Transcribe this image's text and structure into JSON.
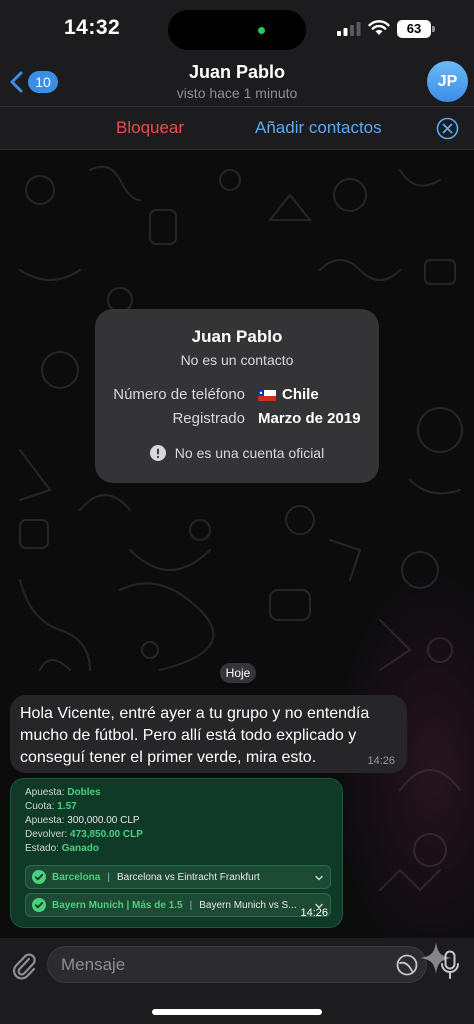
{
  "status_bar": {
    "time": "14:32",
    "battery": "63"
  },
  "header": {
    "back_count": "10",
    "name": "Juan Pablo",
    "last_seen": "visto hace 1 minuto",
    "avatar_initials": "JP"
  },
  "action_bar": {
    "block": "Bloquear",
    "add_contacts": "Añadir contactos"
  },
  "info_card": {
    "name": "Juan Pablo",
    "subtitle": "No es un contacto",
    "phone_label": "Número de teléfono",
    "phone_value": "Chile",
    "registered_label": "Registrado",
    "registered_value": "Marzo de 2019",
    "warning": "No es una cuenta oficial"
  },
  "date_separator": "Hoje",
  "messages": [
    {
      "text": "Hola Vicente, entré ayer a tu grupo y no entendía mucho de fútbol. Pero allí está todo explicado y conseguí tener el primer verde, mira esto.",
      "time": "14:26"
    }
  ],
  "bet_slip": {
    "type_label": "Apuesta:",
    "type_value": "Dobles",
    "odds_label": "Cuota:",
    "odds_value": "1.57",
    "stake_label": "Apuesta:",
    "stake_value": "300,000.00 CLP",
    "return_label": "Devolver:",
    "return_value": "473,850.00 CLP",
    "status_label": "Estado:",
    "status_value": "Ganado",
    "matches": [
      {
        "pick": "Barcelona",
        "event": "Barcelona vs Eintracht Frankfurt"
      },
      {
        "pick": "Bayern Munich | Más de 1.5",
        "event": "Bayern Munich vs S..."
      }
    ],
    "time": "14:26"
  },
  "input": {
    "placeholder": "Mensaje"
  },
  "colors": {
    "accent": "#3a8ee6",
    "danger": "#eb4d4b",
    "win_green": "#49d17d"
  }
}
